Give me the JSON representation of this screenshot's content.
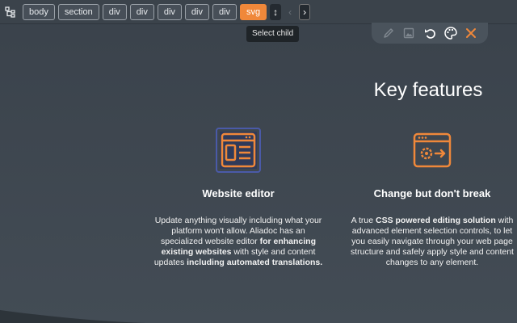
{
  "breadcrumb": {
    "items": [
      "body",
      "section",
      "div",
      "div",
      "div",
      "div",
      "div",
      "svg"
    ],
    "active_index": 7,
    "up_label": "↕",
    "prev_label": "‹",
    "next_label": "›"
  },
  "tooltip": "Select child",
  "toolbar": {
    "icons": [
      "pencil-icon",
      "image-icon",
      "undo-icon",
      "palette-icon",
      "close-icon"
    ]
  },
  "content": {
    "heading": "Key features",
    "features": [
      {
        "icon": "website-editor-icon",
        "title": "Website editor",
        "desc_parts": [
          "Update anything visually including what your platform won't allow. Aliadoc has an specialized website editor ",
          "for enhancing existing websites",
          " with style and content updates ",
          "including automated translations."
        ]
      },
      {
        "icon": "code-settings-icon",
        "title": "Change but don't break",
        "desc_parts": [
          "A true ",
          "CSS powered editing solution",
          " with advanced element selection controls, to let you easily navigate through your web page structure and safely apply style and content changes to any element."
        ]
      }
    ]
  },
  "colors": {
    "accent": "#f0883a",
    "background": "#3f474f",
    "toolbar": "#3b434b"
  }
}
